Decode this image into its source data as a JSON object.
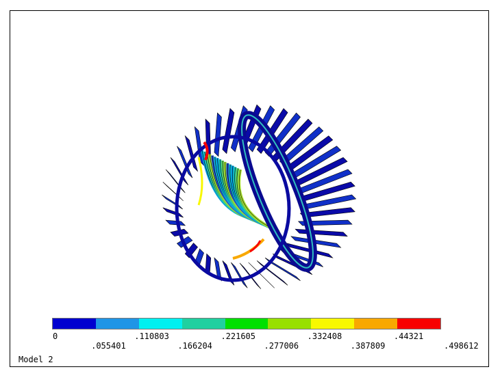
{
  "legend": {
    "colors": [
      "#0000d0",
      "#1f95e6",
      "#00f0f0",
      "#20d0a0",
      "#00e000",
      "#98e000",
      "#f8f800",
      "#f8a800",
      "#f80000"
    ],
    "ticks": [
      "0",
      ".055401",
      ".110803",
      ".166204",
      ".221605",
      ".277006",
      ".332408",
      ".387809",
      ".44321",
      ".498612"
    ]
  },
  "model_label": "Model 2",
  "colors": {
    "dark_blue": "#0a0aa8",
    "mid_blue": "#1030c8",
    "outline": "#000000"
  }
}
